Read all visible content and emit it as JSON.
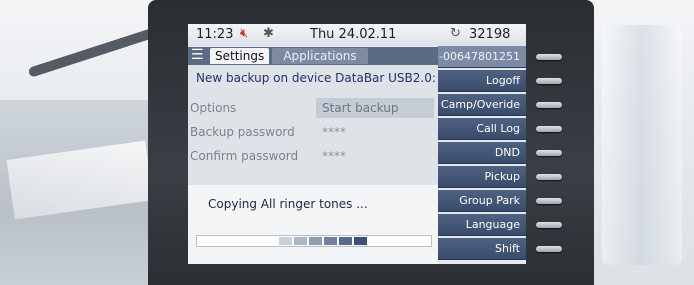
{
  "status_bar": {
    "time": "11:23",
    "mute_icon": "muted-speaker-icon",
    "bluetooth_icon": "bluetooth-icon",
    "date": "Thu 24.02.11",
    "extension_icon": "phone-refresh-icon",
    "extension": "32198"
  },
  "tabs": {
    "menu_icon": "menu-icon",
    "settings": "Settings",
    "applications": "Applications"
  },
  "panel": {
    "heading": "New backup on device DataBar USB2.0:",
    "rows": [
      {
        "label": "Options",
        "value": "Start backup"
      },
      {
        "label": "Backup password",
        "value": "****"
      },
      {
        "label": "Confirm password",
        "value": "****"
      }
    ]
  },
  "progress": {
    "message": "Copying All ringer tones ...",
    "segments_filled": 6,
    "segments_total": 6
  },
  "function_keys": [
    "-00647801251",
    "Logoff",
    "Camp/Overide",
    "Call Log",
    "DND",
    "Pickup",
    "Group Park",
    "Language",
    "Shift"
  ],
  "colors": {
    "accent": "#3a4c6b",
    "tab_bar": "#5b6b84",
    "progress_fill": "#4b5e80",
    "mute_red": "#c0392b"
  }
}
